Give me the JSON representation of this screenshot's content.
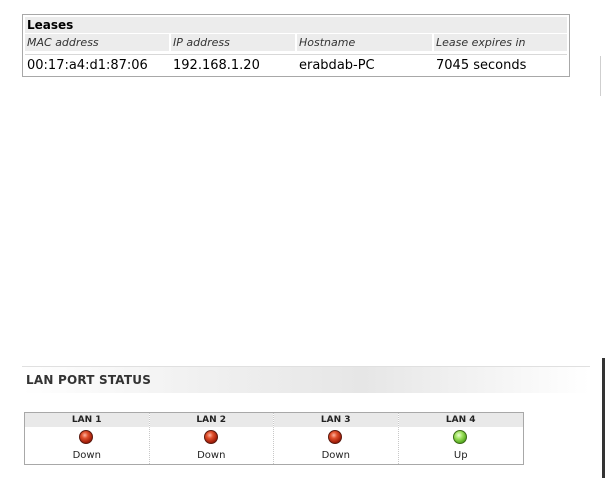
{
  "leases": {
    "title": "Leases",
    "columns": [
      "MAC address",
      "IP address",
      "Hostname",
      "Lease expires in"
    ],
    "rows": [
      {
        "mac": "00:17:a4:d1:87:06",
        "ip": "192.168.1.20",
        "hostname": "erabdab-PC",
        "expires": "7045 seconds"
      }
    ]
  },
  "lan_port_status": {
    "title": "LAN PORT STATUS",
    "ports": [
      {
        "label": "LAN 1",
        "status": "Down",
        "color": "#c0301a"
      },
      {
        "label": "LAN 2",
        "status": "Down",
        "color": "#c0301a"
      },
      {
        "label": "LAN 3",
        "status": "Down",
        "color": "#c0301a"
      },
      {
        "label": "LAN 4",
        "status": "Up",
        "color": "#7cc43e"
      }
    ]
  }
}
